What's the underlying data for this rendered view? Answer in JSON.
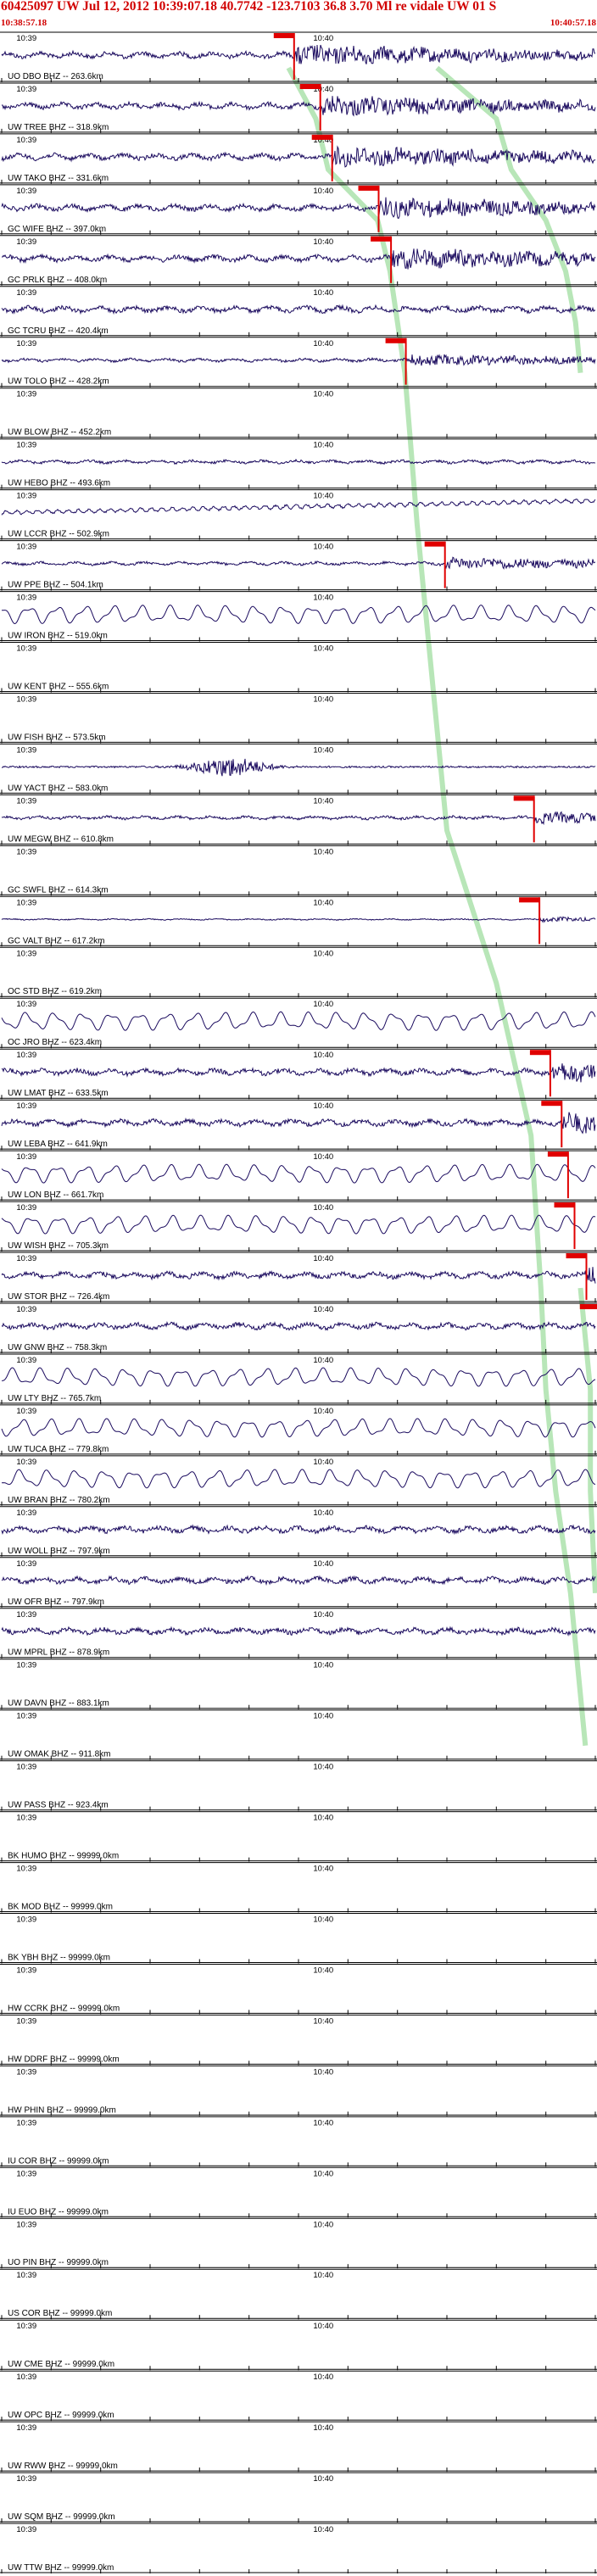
{
  "header": {
    "title": "60425097 UW Jul 12, 2012 10:39:07.18   40.7742 -123.7103 36.8 3.70 Ml re vidale UW 01   S",
    "start_time": "10:38:57.18",
    "end_time": "10:40:57.18"
  },
  "colors": {
    "trace": "#1a0a5e",
    "pick": "#e00000",
    "travel_time_curve": "#b8e6b8",
    "axis": "#000000",
    "header_text": "#d10000"
  },
  "time_labels": {
    "first": "10:39",
    "second": "10:40"
  },
  "chart_data": {
    "type": "line",
    "description": "Record section of seismic traces sorted by epicentral distance",
    "x_unit": "seconds after 10:38:57.18",
    "xlim": [
      0,
      120
    ],
    "tick_labels": [
      "10:39",
      "10:40"
    ],
    "stations": [
      {
        "label": "UO DBO BHZ -- 263.6km",
        "pick": 59.1,
        "amp": "high"
      },
      {
        "label": "UW TREE BHZ -- 318.9km",
        "pick": 64.4,
        "amp": "high"
      },
      {
        "label": "UW TAKO BHZ -- 331.6km",
        "pick": 66.8,
        "amp": "high"
      },
      {
        "label": "GC WIFE BHZ -- 397.0km",
        "pick": 76.2,
        "amp": "high"
      },
      {
        "label": "GC PRLK BHZ -- 408.0km",
        "pick": 78.7,
        "amp": "high"
      },
      {
        "label": "GC TCRU BHZ -- 420.4km",
        "pick": null,
        "amp": "high"
      },
      {
        "label": "UW TOLO BHZ -- 428.2km",
        "pick": 81.7,
        "amp": "med"
      },
      {
        "label": "UW BLOW BHZ -- 452.2km",
        "pick": null,
        "amp": "none"
      },
      {
        "label": "UW HEBO BHZ -- 493.6km",
        "pick": null,
        "amp": "med"
      },
      {
        "label": "UW LCCR BHZ -- 502.9km",
        "pick": null,
        "amp": "drift"
      },
      {
        "label": "UW PPE BHZ -- 504.1km",
        "pick": 89.6,
        "amp": "med"
      },
      {
        "label": "UW IRON BHZ -- 519.0km",
        "pick": null,
        "amp": "wave"
      },
      {
        "label": "UW KENT BHZ -- 555.6km",
        "pick": null,
        "amp": "none"
      },
      {
        "label": "UW FISH BHZ -- 573.5km",
        "pick": null,
        "amp": "none"
      },
      {
        "label": "UW YACT BHZ -- 583.0km",
        "pick": null,
        "amp": "burst"
      },
      {
        "label": "UW MEGW BHZ -- 610.8km",
        "pick": 107.6,
        "amp": "med"
      },
      {
        "label": "GC SWFL BHZ -- 614.3km",
        "pick": null,
        "amp": "none"
      },
      {
        "label": "GC VALT BHZ -- 617.2km",
        "pick": 108.7,
        "amp": "low"
      },
      {
        "label": "OC STD BHZ -- 619.2km",
        "pick": null,
        "amp": "none"
      },
      {
        "label": "OC JRO BHZ -- 623.4km",
        "pick": null,
        "amp": "wave"
      },
      {
        "label": "UW LMAT BHZ -- 633.5km",
        "pick": 110.9,
        "amp": "high"
      },
      {
        "label": "UW LEBA BHZ -- 641.9km",
        "pick": 113.2,
        "amp": "high"
      },
      {
        "label": "UW LON BHZ -- 661.7km",
        "pick": 114.5,
        "amp": "wave"
      },
      {
        "label": "UW WISH BHZ -- 705.3km",
        "pick": 115.8,
        "amp": "wave"
      },
      {
        "label": "UW STOR BHZ -- 726.4km",
        "pick": 118.2,
        "amp": "high"
      },
      {
        "label": "UW GNW BHZ -- 758.3km",
        "pick": 121.0,
        "amp": "high"
      },
      {
        "label": "UW LTY BHZ -- 765.7km",
        "pick": null,
        "amp": "wave"
      },
      {
        "label": "UW TUCA BHZ -- 779.8km",
        "pick": null,
        "amp": "wave"
      },
      {
        "label": "UW BRAN BHZ -- 780.2km",
        "pick": null,
        "amp": "wave"
      },
      {
        "label": "UW WOLL BHZ -- 797.9km",
        "pick": null,
        "amp": "high"
      },
      {
        "label": "UW OFR BHZ -- 797.9km",
        "pick": null,
        "amp": "high"
      },
      {
        "label": "UW MPRL BHZ -- 878.9km",
        "pick": null,
        "amp": "high"
      },
      {
        "label": "UW DAVN BHZ -- 883.1km",
        "pick": null,
        "amp": "none"
      },
      {
        "label": "UW OMAK BHZ -- 911.8km",
        "pick": null,
        "amp": "none"
      },
      {
        "label": "UW PASS BHZ -- 923.4km",
        "pick": null,
        "amp": "none"
      },
      {
        "label": "BK HUMO BHZ -- 99999.0km",
        "pick": null,
        "amp": "none"
      },
      {
        "label": "BK MOD BHZ -- 99999.0km",
        "pick": null,
        "amp": "none"
      },
      {
        "label": "BK YBH BHZ -- 99999.0km",
        "pick": null,
        "amp": "none"
      },
      {
        "label": "HW CCRK BHZ -- 99999.0km",
        "pick": null,
        "amp": "none"
      },
      {
        "label": "HW DDRF BHZ -- 99999.0km",
        "pick": null,
        "amp": "none"
      },
      {
        "label": "HW PHIN BHZ -- 99999.0km",
        "pick": null,
        "amp": "none"
      },
      {
        "label": "IU COR BHZ -- 99999.0km",
        "pick": null,
        "amp": "none"
      },
      {
        "label": "IU EUO BHZ -- 99999.0km",
        "pick": null,
        "amp": "none"
      },
      {
        "label": "UO PIN BHZ -- 99999.0km",
        "pick": null,
        "amp": "none"
      },
      {
        "label": "US COR BHZ -- 99999.0km",
        "pick": null,
        "amp": "none"
      },
      {
        "label": "UW CME BHZ -- 99999.0km",
        "pick": null,
        "amp": "none"
      },
      {
        "label": "UW OPC BHZ -- 99999.0km",
        "pick": null,
        "amp": "none"
      },
      {
        "label": "UW RWW BHZ -- 99999.0km",
        "pick": null,
        "amp": "none"
      },
      {
        "label": "UW SQM BHZ -- 99999.0km",
        "pick": null,
        "amp": "none"
      },
      {
        "label": "UW TTW BHZ -- 99999.0km",
        "pick": null,
        "amp": "none"
      }
    ]
  }
}
